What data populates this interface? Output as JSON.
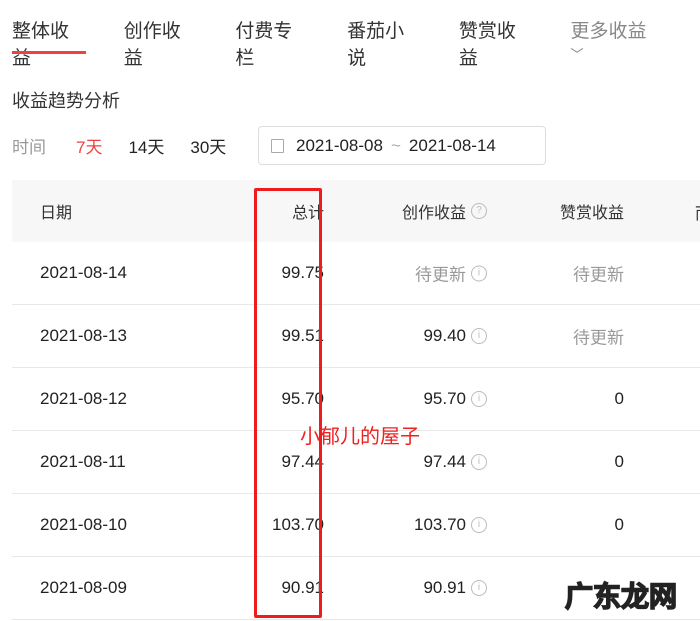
{
  "tabs": [
    "整体收益",
    "创作收益",
    "付费专栏",
    "番茄小说",
    "赞赏收益",
    "更多收益"
  ],
  "section_title": "收益趋势分析",
  "filter": {
    "label": "时间",
    "options": [
      "7天",
      "14天",
      "30天"
    ],
    "start": "2021-08-08",
    "sep": "~",
    "end": "2021-08-14"
  },
  "table": {
    "headers": [
      "日期",
      "总计",
      "创作收益",
      "赞赏收益",
      "而"
    ],
    "rows": [
      {
        "date": "2021-08-14",
        "total": "99.75",
        "creation": "待更新",
        "reward": "待更新"
      },
      {
        "date": "2021-08-13",
        "total": "99.51",
        "creation": "99.40",
        "reward": "待更新"
      },
      {
        "date": "2021-08-12",
        "total": "95.70",
        "creation": "95.70",
        "reward": "0"
      },
      {
        "date": "2021-08-11",
        "total": "97.44",
        "creation": "97.44",
        "reward": "0"
      },
      {
        "date": "2021-08-10",
        "total": "103.70",
        "creation": "103.70",
        "reward": "0"
      },
      {
        "date": "2021-08-09",
        "total": "90.91",
        "creation": "90.91",
        "reward": ""
      }
    ]
  },
  "watermark": "小郁儿的屋子",
  "watermark2": "广东龙网"
}
